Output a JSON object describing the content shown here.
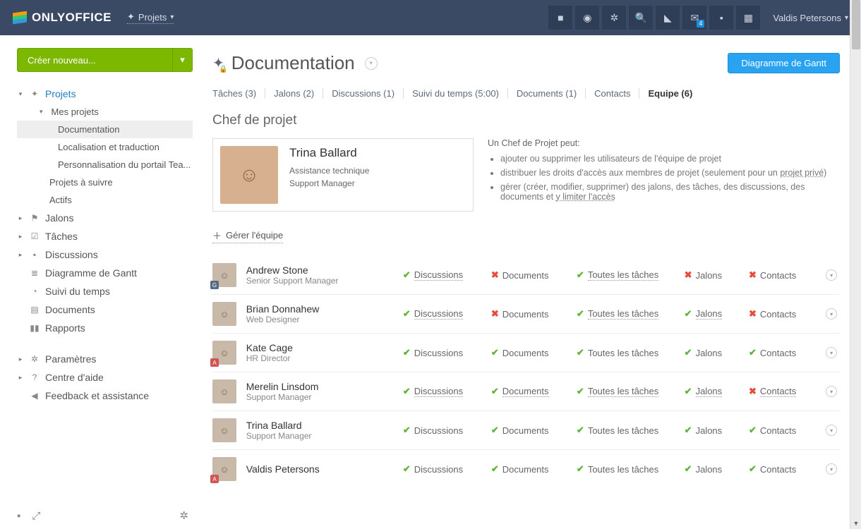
{
  "topbar": {
    "product": "ONLYOFFICE",
    "module": "Projets",
    "mail_badge": "4",
    "user": "Valdis Petersons"
  },
  "sidebar": {
    "create_label": "Créer nouveau...",
    "items": {
      "projets": "Projets",
      "mes_projets": "Mes projets",
      "documentation": "Documentation",
      "localisation": "Localisation et traduction",
      "personnalisation": "Personnalisation du portail Tea...",
      "projets_a_suivre": "Projets à suivre",
      "actifs": "Actifs",
      "jalons": "Jalons",
      "taches": "Tâches",
      "discussions": "Discussions",
      "gantt": "Diagramme de Gantt",
      "suivi": "Suivi du temps",
      "documents": "Documents",
      "rapports": "Rapports",
      "parametres": "Paramètres",
      "aide": "Centre d'aide",
      "feedback": "Feedback et assistance"
    }
  },
  "page": {
    "title": "Documentation",
    "gantt_button": "Diagramme de Gantt",
    "section_title": "Chef de projet",
    "manage_team": "Gérer l'équipe"
  },
  "tabs": [
    "Tâches (3)",
    "Jalons (2)",
    "Discussions (1)",
    "Suivi du temps (5:00)",
    "Documents (1)",
    "Contacts",
    "Equipe (6)"
  ],
  "chef": {
    "name": "Trina Ballard",
    "line1": "Assistance technique",
    "line2": "Support Manager",
    "desc_lead": "Un Chef de Projet peut:",
    "desc_items": [
      "ajouter ou supprimer les utilisateurs de l'équipe de projet",
      "distribuer les droits d'accès aux membres de projet (seulement pour un ",
      "gérer (créer, modifier, supprimer) des jalons, des tâches, des discussions, des documents et "
    ],
    "desc_link1": "projet privé",
    "desc_link2": "y limiter l'accès"
  },
  "perm_labels": {
    "discussions": "Discussions",
    "documents": "Documents",
    "toutes_taches": "Toutes les tâches",
    "jalons": "Jalons",
    "contacts": "Contacts"
  },
  "team": [
    {
      "name": "Andrew Stone",
      "role": "Senior Support Manager",
      "badge": "G",
      "badge_red": false,
      "perms": {
        "discussions": "allow-link",
        "documents": "deny",
        "toutes_taches": "allow-link",
        "jalons": "deny",
        "contacts": "deny"
      }
    },
    {
      "name": "Brian Donnahew",
      "role": "Web Designer",
      "badge": null,
      "perms": {
        "discussions": "allow-link",
        "documents": "deny",
        "toutes_taches": "allow-link",
        "jalons": "allow-link",
        "contacts": "deny"
      }
    },
    {
      "name": "Kate Cage",
      "role": "HR Director",
      "badge": "A",
      "badge_red": true,
      "perms": {
        "discussions": "allow",
        "documents": "allow",
        "toutes_taches": "allow",
        "jalons": "allow",
        "contacts": "allow"
      }
    },
    {
      "name": "Merelin Linsdom",
      "role": "Support Manager",
      "badge": null,
      "perms": {
        "discussions": "allow-link",
        "documents": "allow-link",
        "toutes_taches": "allow-link",
        "jalons": "allow-link",
        "contacts": "deny-link"
      }
    },
    {
      "name": "Trina Ballard",
      "role": "Support Manager",
      "badge": null,
      "perms": {
        "discussions": "allow",
        "documents": "allow",
        "toutes_taches": "allow",
        "jalons": "allow",
        "contacts": "allow"
      }
    },
    {
      "name": "Valdis Petersons",
      "role": "",
      "badge": "A",
      "badge_red": true,
      "perms": {
        "discussions": "allow",
        "documents": "allow",
        "toutes_taches": "allow",
        "jalons": "allow",
        "contacts": "allow"
      }
    }
  ]
}
